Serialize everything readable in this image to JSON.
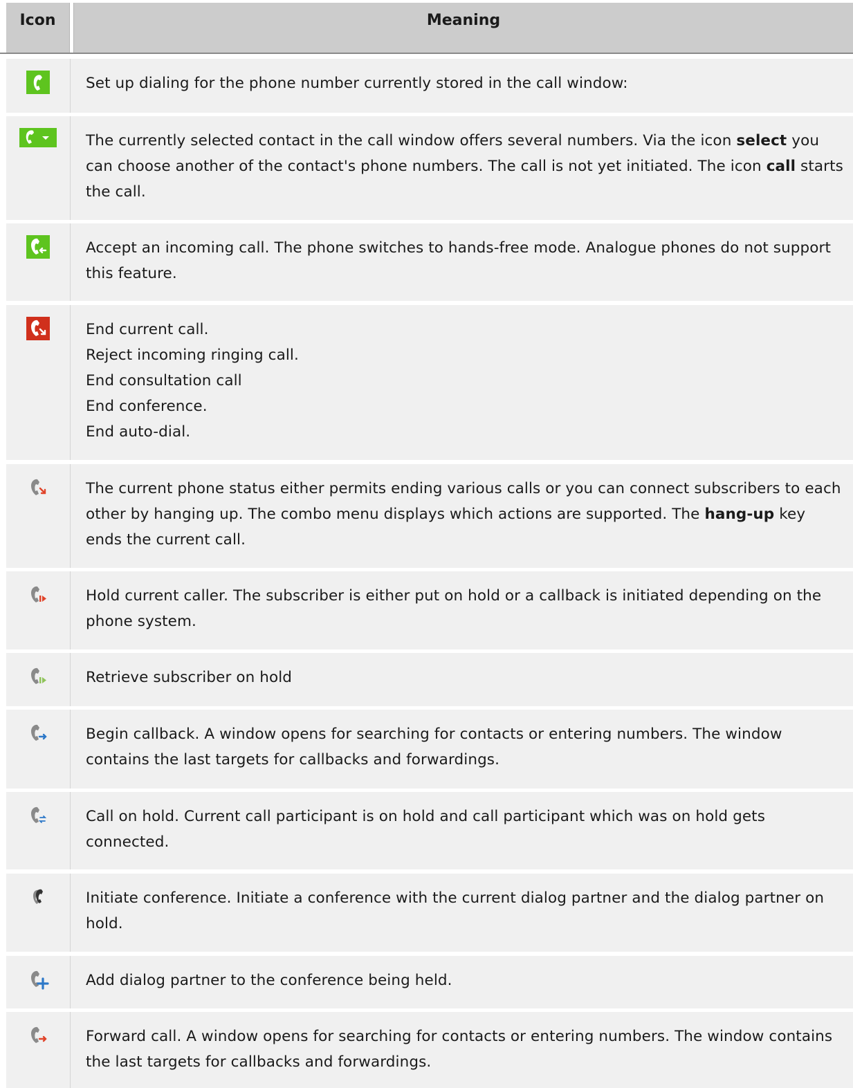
{
  "header": {
    "icon_col": "Icon",
    "meaning_col": "Meaning"
  },
  "rows": [
    {
      "icon": "phone-green-icon",
      "segments": [
        {
          "t": "Set up dialing for the phone number currently stored in the call window:"
        }
      ]
    },
    {
      "icon": "phone-green-dropdown-icon",
      "segments": [
        {
          "t": "The currently selected contact in the call window offers several numbers. Via the icon "
        },
        {
          "t": "select",
          "b": true
        },
        {
          "t": " you can choose another of the contact's phone numbers. The call is not yet initiated. The icon "
        },
        {
          "t": "call",
          "b": true
        },
        {
          "t": " starts the call."
        }
      ]
    },
    {
      "icon": "phone-accept-icon",
      "segments": [
        {
          "t": "Accept an incoming call. The phone switches to hands-free mode. Analogue phones do not support this feature."
        }
      ]
    },
    {
      "icon": "phone-end-red-icon",
      "lines": [
        "End current call.",
        "Reject incoming ringing call.",
        "End consultation call",
        "End conference.",
        "End auto-dial."
      ]
    },
    {
      "icon": "phone-hangup-grey-icon",
      "segments": [
        {
          "t": "The current phone status either permits ending various calls or you can connect subscribers to each other by hanging up. The combo menu displays which actions are supported. The "
        },
        {
          "t": "hang-up",
          "b": true
        },
        {
          "t": " key ends the current call."
        }
      ]
    },
    {
      "icon": "phone-hold-icon",
      "segments": [
        {
          "t": "Hold current caller. The subscriber is either put on hold or a callback is initiated depending on the phone system."
        }
      ]
    },
    {
      "icon": "phone-retrieve-icon",
      "segments": [
        {
          "t": "Retrieve subscriber on hold"
        }
      ]
    },
    {
      "icon": "phone-callback-icon",
      "segments": [
        {
          "t": "Begin callback. A window opens for searching for contacts or entering numbers. The window contains the last targets for callbacks and forwardings."
        }
      ]
    },
    {
      "icon": "phone-toggle-icon",
      "segments": [
        {
          "t": "Call on hold. Current call participant is on hold and call participant which was on hold gets connected."
        }
      ]
    },
    {
      "icon": "phone-conference-icon",
      "segments": [
        {
          "t": "Initiate conference. Initiate a conference with the current dialog partner and the dialog partner on hold."
        }
      ]
    },
    {
      "icon": "phone-add-partner-icon",
      "segments": [
        {
          "t": "Add dialog partner to the conference being held."
        }
      ]
    },
    {
      "icon": "phone-forward-icon",
      "segments": [
        {
          "t": "Forward call. A window opens for searching for contacts or entering numbers. The window contains the last targets for callbacks and forwardings."
        }
      ]
    }
  ]
}
